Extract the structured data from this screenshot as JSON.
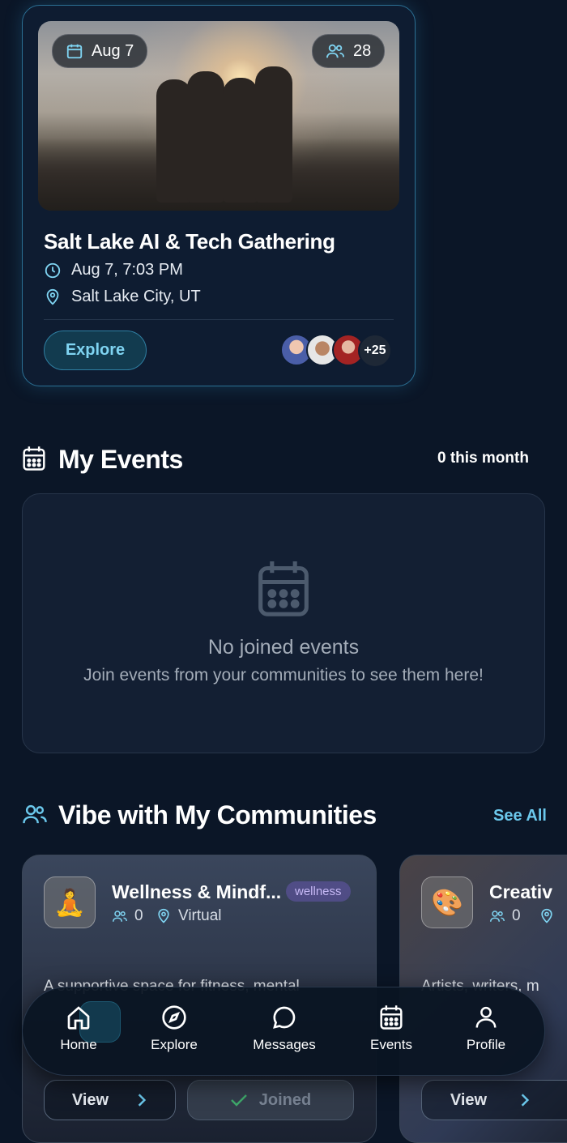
{
  "event_card": {
    "date_badge": "Aug 7",
    "attendee_count": "28",
    "title": "Salt Lake AI & Tech Gathering",
    "datetime": "Aug 7, 7:03 PM",
    "location": "Salt Lake City, UT",
    "explore_label": "Explore",
    "more_attendees": "+25"
  },
  "my_events": {
    "title": "My Events",
    "count_label": "0 this month",
    "empty_title": "No joined events",
    "empty_subtitle": "Join events from your communities to see them here!"
  },
  "communities": {
    "title": "Vibe with My Communities",
    "see_all": "See All",
    "cards": [
      {
        "name": "Wellness & Mindf...",
        "tag": "wellness",
        "members": "0",
        "location": "Virtual",
        "description": "A supportive space for fitness, mental",
        "icon": "🧘",
        "view_label": "View",
        "joined_label": "Joined"
      },
      {
        "name": "Creativ",
        "members": "0",
        "description": "Artists, writers, m",
        "icon": "🎨",
        "view_label": "View"
      }
    ]
  },
  "nav": {
    "items": [
      {
        "label": "Home",
        "icon": "home-icon",
        "active": true
      },
      {
        "label": "Explore",
        "icon": "compass-icon"
      },
      {
        "label": "Messages",
        "icon": "message-icon"
      },
      {
        "label": "Events",
        "icon": "calendar-icon"
      },
      {
        "label": "Profile",
        "icon": "user-icon"
      }
    ]
  },
  "colors": {
    "background": "#0b1627",
    "accent": "#6bc8ec",
    "card_border": "#2b6f93",
    "tag_purple": "#c6b8f5"
  }
}
